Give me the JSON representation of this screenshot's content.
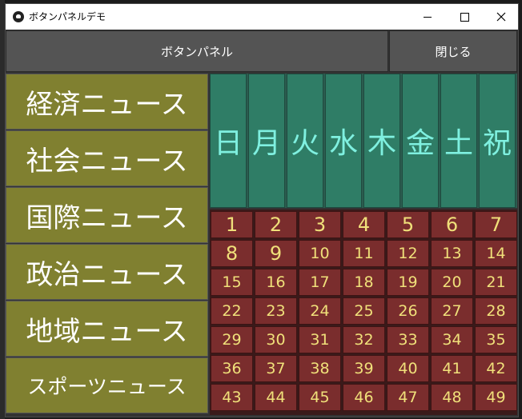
{
  "window": {
    "title": "ボタンパネルデモ"
  },
  "toolbar": {
    "title_button": "ボタンパネル",
    "close_button": "閉じる"
  },
  "news": [
    "経済ニュース",
    "社会ニュース",
    "国際ニュース",
    "政治ニュース",
    "地域ニュース",
    "スポーツニュース"
  ],
  "weekdays": [
    "日",
    "月",
    "火",
    "水",
    "木",
    "金",
    "土",
    "祝"
  ],
  "dates": [
    "1",
    "2",
    "3",
    "4",
    "5",
    "6",
    "7",
    "8",
    "9",
    "10",
    "11",
    "12",
    "13",
    "14",
    "15",
    "16",
    "17",
    "18",
    "19",
    "20",
    "21",
    "22",
    "23",
    "24",
    "25",
    "26",
    "27",
    "28",
    "29",
    "30",
    "31",
    "32",
    "33",
    "34",
    "35",
    "36",
    "37",
    "38",
    "39",
    "40",
    "41",
    "42",
    "43",
    "44",
    "45",
    "46",
    "47",
    "48",
    "49"
  ],
  "colors": {
    "news_bg": "#808030",
    "weekday_bg": "#2f7d66",
    "weekday_text": "#7ff0e0",
    "date_bg": "#7a2d2d",
    "date_text": "#f0e07a",
    "toolbar_bg": "#545454"
  }
}
